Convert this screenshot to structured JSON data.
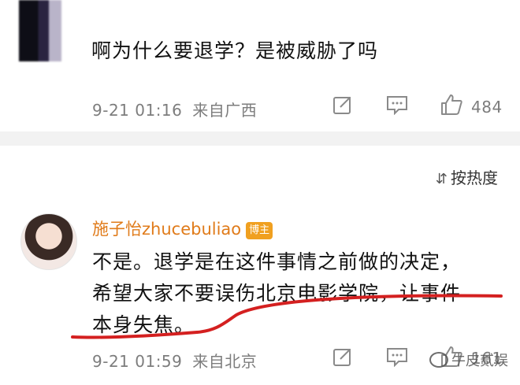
{
  "comment1": {
    "text": "啊为什么要退学？是被威胁了吗",
    "time": "9-21 01:16",
    "location": "来自广西",
    "likes": "484"
  },
  "sort": {
    "label": "按热度"
  },
  "comment2": {
    "username": "施子怡zhucebuliao",
    "badge": "博主",
    "line1": "不是。退学是在这件事情之前做的决定，",
    "line2": "希望大家不要误伤北京电影学院，让事件",
    "line3": "本身失焦。",
    "time": "9-21 01:59",
    "location": "来自北京",
    "likes": "161"
  },
  "watermark": "牛皮贰娱",
  "colors": {
    "username": "#e07b1a",
    "underline": "#d42020",
    "meta": "#7d7d7d"
  },
  "icons": [
    "share-icon",
    "comment-icon",
    "like-icon",
    "sort-icon",
    "wechat-logo-icon"
  ]
}
